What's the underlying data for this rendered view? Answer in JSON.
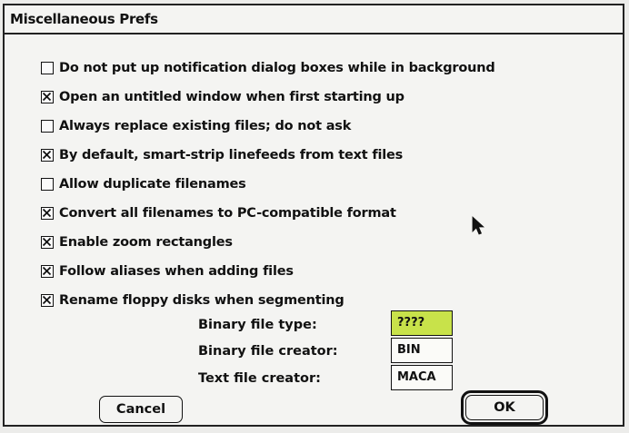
{
  "dialog": {
    "title": "Miscellaneous Prefs",
    "options": [
      {
        "label": "Do not put up notification dialog boxes while in background",
        "checked": false
      },
      {
        "label": "Open an untitled window when first starting up",
        "checked": true
      },
      {
        "label": "Always replace existing files; do not ask",
        "checked": false
      },
      {
        "label": "By default, smart-strip linefeeds from text files",
        "checked": true
      },
      {
        "label": "Allow duplicate filenames",
        "checked": false
      },
      {
        "label": "Convert all filenames to PC-compatible format",
        "checked": true
      },
      {
        "label": "Enable zoom rectangles",
        "checked": true
      },
      {
        "label": "Follow aliases when adding files",
        "checked": true
      },
      {
        "label": "Rename floppy disks when segmenting",
        "checked": true
      }
    ],
    "fields": {
      "binary_type": {
        "label": "Binary file type:",
        "value": "????"
      },
      "binary_creator": {
        "label": "Binary file creator:",
        "value": "BIN"
      },
      "text_creator": {
        "label": "Text file creator:",
        "value": "MACA"
      }
    },
    "buttons": {
      "cancel": "Cancel",
      "ok": "OK"
    },
    "colors": {
      "selection": "#c8e24a"
    },
    "cursor_icon": "arrow-pointer-icon"
  }
}
